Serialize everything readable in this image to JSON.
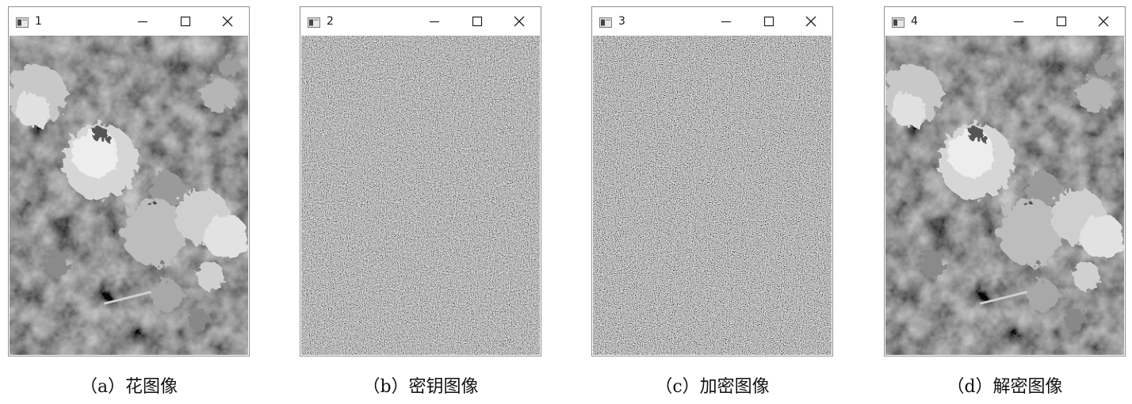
{
  "windows": [
    {
      "title": "1",
      "content": "flower-photo",
      "caption": "（a）花图像"
    },
    {
      "title": "2",
      "content": "noise",
      "caption": "（b）密钥图像"
    },
    {
      "title": "3",
      "content": "noise",
      "caption": "（c）加密图像"
    },
    {
      "title": "4",
      "content": "flower-photo",
      "caption": "（d）解密图像"
    }
  ],
  "icons": {
    "app": "image-window-icon",
    "minimize": "minimize-icon",
    "maximize": "maximize-icon",
    "close": "close-icon"
  },
  "colors": {
    "window_border": "#8f8f8f",
    "titlebar": "#ffffff",
    "caption_text": "#111111"
  }
}
